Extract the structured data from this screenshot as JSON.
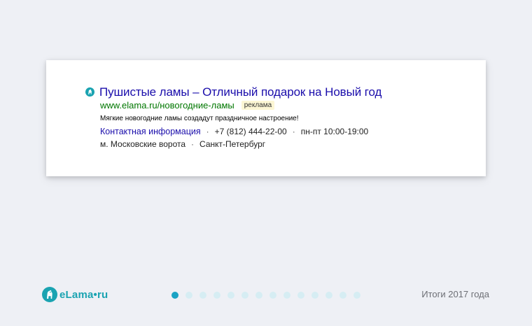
{
  "ad": {
    "title": "Пушистые ламы – Отличный подарок на Новый год",
    "url": "www.elama.ru/новогодние-ламы",
    "badge": "реклама",
    "description": "Мягкие новогодние ламы создадут праздничное настроение!",
    "contact_link": "Контактная информация",
    "separator": "·",
    "phone": "+7 (812) 444-22-00",
    "hours": "пн-пт 10:00-19:00",
    "metro": "м. Московские ворота",
    "city": "Санкт-Петербург"
  },
  "footer": {
    "logo_text": "eLama•ru",
    "label": "Итоги 2017 года",
    "slides": {
      "count": 14,
      "active": 0
    }
  },
  "colors": {
    "background": "#eef0f5",
    "link": "#1a0dab",
    "url": "#007700",
    "badge_bg": "#fcf6d4",
    "brand": "#1aa3b1",
    "dot_active": "#1aa3c4",
    "dot_inactive": "#d6edf3"
  },
  "icons": {
    "favicon": "elama-favicon-icon",
    "logo": "elama-logo-icon"
  }
}
